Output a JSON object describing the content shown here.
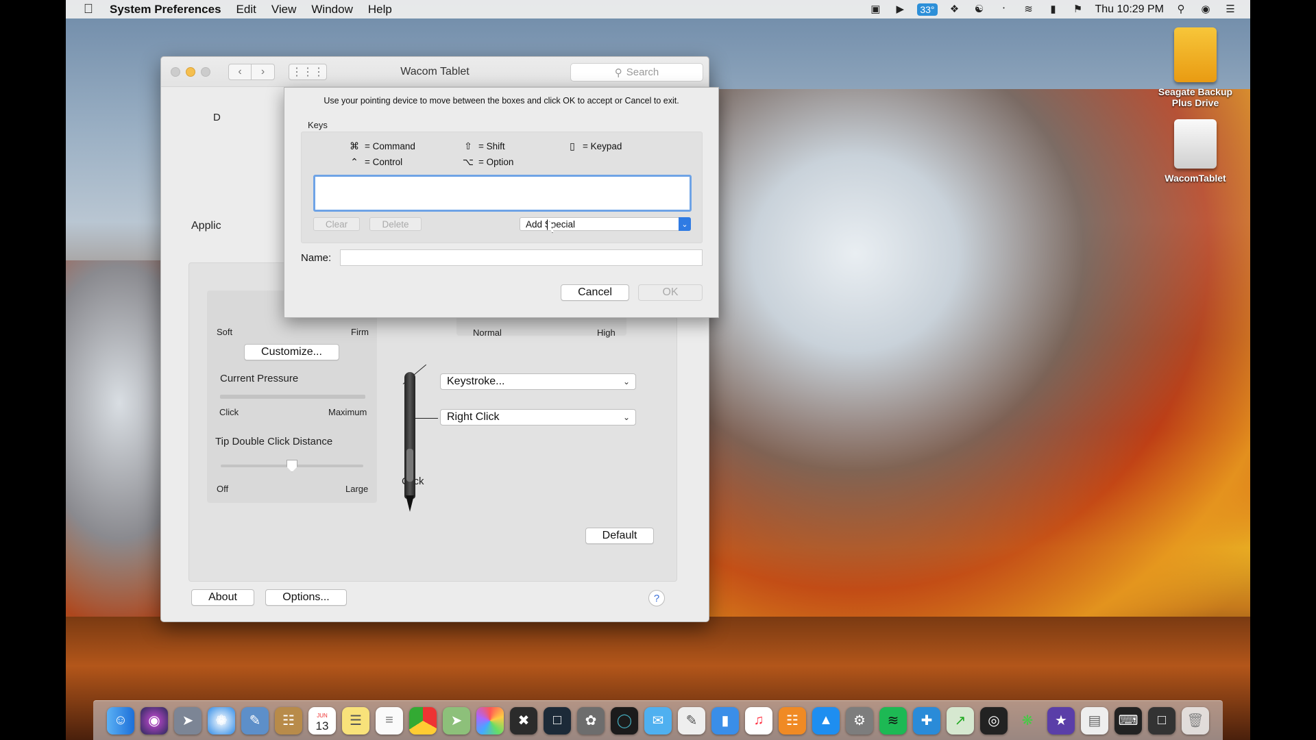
{
  "menubar": {
    "app_name": "System Preferences",
    "menus": [
      "Edit",
      "View",
      "Window",
      "Help"
    ],
    "temperature": "33°",
    "clock": "Thu 10:29 PM"
  },
  "desktop": {
    "drive1": "Seagate Backup Plus Drive",
    "drive2": "WacomTablet"
  },
  "window": {
    "title": "Wacom Tablet",
    "search_placeholder": "Search",
    "partial_label_d": "D",
    "partial_label_applic": "Applic",
    "tip_feel": {
      "soft": "Soft",
      "firm": "Firm",
      "customize": "Customize..."
    },
    "current_pressure": {
      "label": "Current Pressure",
      "min": "Click",
      "max": "Maximum",
      "value": 0
    },
    "double_click": {
      "label": "Tip Double Click Distance",
      "min": "Off",
      "max": "Large",
      "value": 0.5
    },
    "tilt": {
      "min": "Normal",
      "max": "High"
    },
    "upper_button": "Keystroke...",
    "lower_button": "Right Click",
    "tip_label": "Click",
    "default_btn": "Default",
    "about_btn": "About",
    "options_btn": "Options...",
    "help_btn": "?"
  },
  "sheet": {
    "instructions": "Use your pointing device to move between the boxes and click OK to accept or Cancel to exit.",
    "keys_label": "Keys",
    "legend": {
      "command": "= Command",
      "control": "= Control",
      "shift": "= Shift",
      "option": "= Option",
      "keypad": "= Keypad"
    },
    "keystroke_value": "",
    "clear_btn": "Clear",
    "delete_btn": "Delete",
    "add_special": "Add Special",
    "name_label": "Name:",
    "name_value": "",
    "cancel_btn": "Cancel",
    "ok_btn": "OK"
  },
  "dock_apps": [
    "Finder",
    "Siri",
    "Launchpad",
    "Safari",
    "Preview",
    "Contacts",
    "Calendar",
    "Notes",
    "Reminders",
    "Chrome",
    "Maps",
    "Photos",
    "Final Cut",
    "Lightroom",
    "Motion",
    "QuickTime",
    "Messages",
    "Keynote",
    "Pages",
    "iTunes",
    "Books",
    "App Store",
    "System Preferences",
    "Spotify",
    "Wacom",
    "Activity Monitor",
    "Mail",
    "Capture",
    "iMovie",
    "Documents",
    "Terminal",
    "Screen",
    "Trash"
  ],
  "calendar_day": "13",
  "calendar_month": "JUN"
}
